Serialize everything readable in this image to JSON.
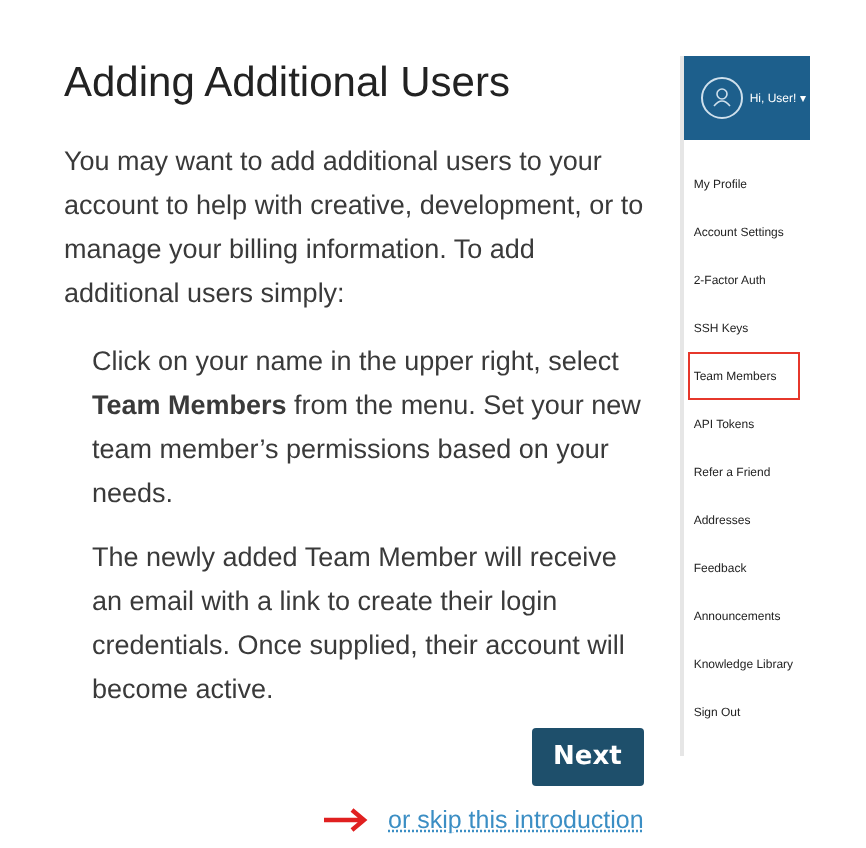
{
  "title": "Adding Additional Users",
  "intro": "You may want to add additional users to your account to help with creative, development, or to manage your billing information. To add additional users simply:",
  "steps": [
    "Click on your name in the upper right, select **Team Members** from the menu. Set your new team member’s permissions based on your needs.",
    "The newly added Team Member will receive an email with a link to create their login credentials. Once supplied, their account will become active."
  ],
  "next_button": "Next",
  "skip_link": "or skip this introduction",
  "menu": {
    "user": "Hi, User!",
    "caret": "▾",
    "items": [
      {
        "label": "My Profile",
        "selected": false
      },
      {
        "label": "Account Settings",
        "selected": false
      },
      {
        "label": "2-Factor Auth",
        "selected": false
      },
      {
        "label": "SSH Keys",
        "selected": false
      },
      {
        "label": "Team Members",
        "selected": true
      },
      {
        "label": "API Tokens",
        "selected": false
      },
      {
        "label": "Refer a Friend",
        "selected": false
      },
      {
        "label": "Addresses",
        "selected": false
      },
      {
        "label": "Feedback",
        "selected": false
      },
      {
        "label": "Announcements",
        "selected": false
      },
      {
        "label": "Knowledge Library",
        "selected": false
      },
      {
        "label": "Sign Out",
        "selected": false
      }
    ]
  }
}
